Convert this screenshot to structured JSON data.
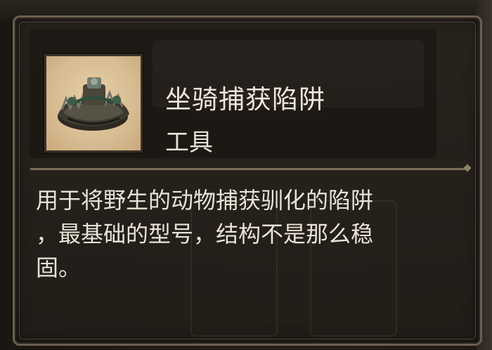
{
  "item": {
    "name": "坐骑捕获陷阱",
    "type": "工具",
    "icon": "mount-trap-icon",
    "description_lines": [
      "用于将野生的动物捕获驯化的陷阱",
      "，最基础的型号，结构不是那么稳",
      "固。"
    ]
  },
  "colors": {
    "frame_border": "#6b5f50",
    "panel_bg": "#211d18",
    "text": "#ece6da",
    "icon_bg": "#dcc39b"
  }
}
